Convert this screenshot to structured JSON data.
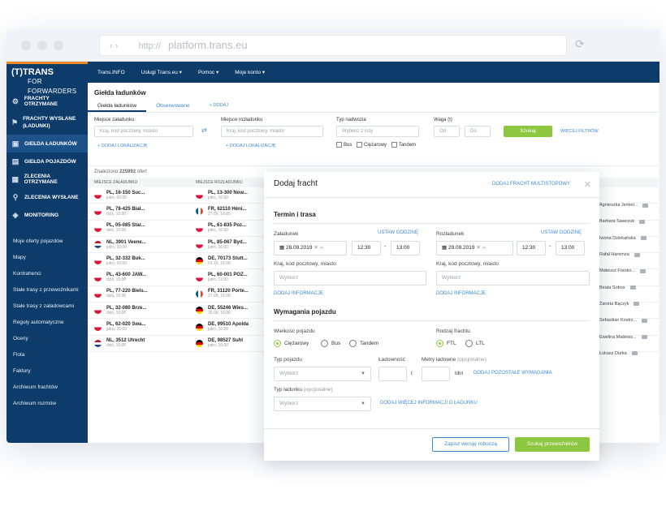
{
  "browser": {
    "url_protocol": "http://",
    "url_host": "platform.trans.eu"
  },
  "logo": {
    "brand": "(T)TRANS",
    "sub": "FOR FORWARDERS"
  },
  "topnav": [
    "Trans.INFO",
    "Usługi Trans.eu ▾",
    "Pomoc ▾",
    "Moje konto ▾"
  ],
  "sidebar": {
    "items": [
      {
        "label": "FRACHTY OTRZYMANE",
        "icon": "freight-received-icon"
      },
      {
        "label": "FRACHTY WYSŁANE (ŁADUNKI)",
        "icon": "freight-sent-icon"
      },
      {
        "label": "GIEŁDA ŁADUNKÓW",
        "icon": "cargo-exchange-icon"
      },
      {
        "label": "GIEŁDA POJAZDÓW",
        "icon": "vehicle-exchange-icon"
      },
      {
        "label": "ZLECENIA OTRZYMANE",
        "icon": "orders-received-icon"
      },
      {
        "label": "ZLECENIA WYSŁANE",
        "icon": "orders-sent-icon"
      },
      {
        "label": "MONITORING",
        "icon": "monitoring-icon"
      }
    ],
    "links": [
      "Moje oferty pojazdów",
      "Mapy",
      "Kontrahenci",
      "Stałe trasy z przewoźnikami",
      "Stałe trasy z załadowcami",
      "Reguły automatyczne",
      "Oceny",
      "Flota",
      "Faktury",
      "Archiwum frachtów",
      "Archiwum rozmów"
    ]
  },
  "page": {
    "title": "Giełda ładunków",
    "tabs": [
      "Giełda ładunków",
      "Obserwowane",
      "+ DODAJ"
    ],
    "filters": {
      "loading_label": "Miejsce załadunku",
      "loading_ph": "Kraj, kod pocztowy, miasto",
      "unloading_label": "Miejsce rozładunku",
      "unloading_ph": "Kraj, kod pocztowy, miasto",
      "add_location": "+ DODAJ LOKALIZACJĘ",
      "body_type_label": "Typ nadwozia",
      "body_type_ph": "Wybierz z listy",
      "weight_label": "Waga (t)",
      "weight_from": "Od",
      "weight_to": "Do",
      "truck_types": [
        "Bus",
        "Ciężarowy",
        "Tandem"
      ],
      "search_btn": "Szukaj",
      "more_filters": "WIĘCEJ FILTRÓW"
    },
    "found_prefix": "Znaleziono",
    "found_count": "225992",
    "found_suffix": "ofert",
    "col_loading": "MIEJSCE ZAŁADUNKU",
    "col_unloading": "MIEJSCE ROZŁADUNKU"
  },
  "rows": [
    {
      "f1": "pl",
      "l1": "PL, 16-150 Suc...",
      "d1": "jutro, 00:00",
      "f2": "pl",
      "l2": "PL, 13-300 Now...",
      "d2": "jutro, 16:00"
    },
    {
      "f1": "pl",
      "l1": "PL, 78-425 Biał...",
      "d1": "dziś, 10:00",
      "f2": "fr",
      "l2": "FR, 62110 Héni...",
      "d2": "27.09, 16:00"
    },
    {
      "f1": "pl",
      "l1": "PL, 05-085 Star...",
      "d1": "dziś, 10:00",
      "f2": "pl",
      "l2": "PL, 61-835 Poz...",
      "d2": "jutro, 16:00"
    },
    {
      "f1": "nl",
      "l1": "NL, 3901 Veene...",
      "d1": "jutro, 10:00",
      "f2": "pl",
      "l2": "PL, 85-067 Byd...",
      "d2": "jutro, 16:00"
    },
    {
      "f1": "pl",
      "l1": "PL, 32-332 Buk...",
      "d1": "jutro, 10:00",
      "f2": "de",
      "l2": "DE, 70173 Stutt...",
      "d2": "01.10, 16:00"
    },
    {
      "f1": "pl",
      "l1": "PL, 43-600 JAW...",
      "d1": "dziś, 15:00",
      "f2": "pl",
      "l2": "PL, 60-001 POZ...",
      "d2": "jutro, 11:00"
    },
    {
      "f1": "pl",
      "l1": "PL, 77-220 Biels...",
      "d1": "dziś, 10:00",
      "f2": "fr",
      "l2": "FR, 31120 Porte...",
      "d2": "27.09, 16:00"
    },
    {
      "f1": "pl",
      "l1": "PL, 32-080 Brze...",
      "d1": "dziś, 10:00",
      "f2": "de",
      "l2": "DE, 55246 Wies...",
      "d2": "30.09, 16:00"
    },
    {
      "f1": "pl",
      "l1": "PL, 62-020 Swa...",
      "d1": "jutro, 16:00",
      "f2": "de",
      "l2": "DE, 99510 Apolda",
      "d2": "jutro, 16:00"
    },
    {
      "f1": "nl",
      "l1": "NL, 3512 Utrecht",
      "d1": "dziś, 10:00",
      "f2": "de",
      "l2": "DE, 98527 Suhl",
      "d2": "jutro, 16:00"
    }
  ],
  "people": [
    "Agnieszka Jemiel...",
    "Barbara Sawczuk",
    "Iwona Dziekańska",
    "Rafał Haremza",
    "Mateusz Franko...",
    "Beata Sobos",
    "Żaneta Bączyk",
    "Sebastian Kostrz...",
    "Ewelina Matiews...",
    "Łukasz Durka"
  ],
  "modal": {
    "title": "Dodaj fracht",
    "multi": "DODAJ FRACHT MULTISTOPOWY",
    "section1": "Termin i trasa",
    "load_label": "Załadunek",
    "unload_label": "Rozładunek",
    "set_hour": "USTAW GODZINĘ",
    "load_date": "28.09.2019",
    "unload_date": "29.09.2019",
    "load_from": "12:30",
    "load_to": "13:00",
    "unload_from": "12:30",
    "unload_to": "13:00",
    "place_label": "Kraj, kod pocztowy, miasto",
    "place_ph": "Wybierz",
    "add_info": "DODAJ INFORMACJE",
    "section2": "Wymagania pojazdu",
    "size_label": "Wielkość pojazdu",
    "sizes": [
      "Ciężarowy",
      "Bus",
      "Tandem"
    ],
    "type_label": "Rodzaj frachtu",
    "types": [
      "FTL",
      "LTL"
    ],
    "vehicle_type_label": "Typ pojazdu",
    "vehicle_type_ph": "Wybierz",
    "capacity_label": "Ładowność",
    "capacity_unit": "t",
    "ldm_label": "Metry ładowne",
    "ldm_optional": "(opcjonalne)",
    "ldm_unit": "ldm",
    "more_req": "DODAJ POZOSTAŁE WYMAGANIA",
    "cargo_label": "Typ ładunku",
    "cargo_optional": "(opcjonalne)",
    "cargo_ph": "Wybierz",
    "more_cargo": "DODAJ WIĘCEJ INFORMACJI O ŁADUNKU",
    "save_draft": "Zapisz wersję roboczą",
    "search_carriers": "Szukaj przewoźników"
  }
}
